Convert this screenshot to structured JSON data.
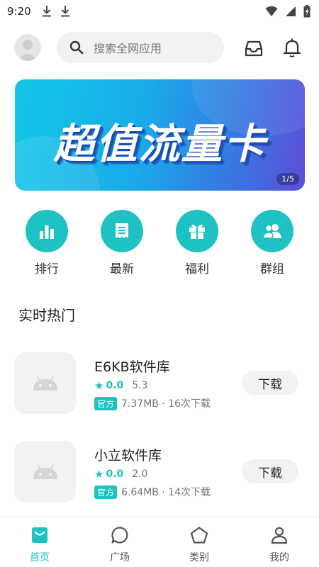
{
  "status_bar": {
    "time": "9:20"
  },
  "header": {
    "search_placeholder": "搜索全网应用"
  },
  "banner": {
    "title": "超值流量卡",
    "pager": "1/5"
  },
  "quick_actions": [
    {
      "label": "排行",
      "icon": "bar-chart-icon"
    },
    {
      "label": "最新",
      "icon": "receipt-icon"
    },
    {
      "label": "福利",
      "icon": "gift-icon"
    },
    {
      "label": "群组",
      "icon": "group-icon"
    }
  ],
  "section": {
    "title": "实时热门"
  },
  "apps": [
    {
      "name": "E6KB软件库",
      "rating": "0.0",
      "version": "5.3",
      "tag": "官方",
      "info": "7.37MB · 16次下载",
      "button": "下载"
    },
    {
      "name": "小立软件库",
      "rating": "0.0",
      "version": "2.0",
      "tag": "官方",
      "info": "6.64MB · 14次下载",
      "button": "下载"
    }
  ],
  "tabs": [
    {
      "label": "首页",
      "icon": "home-bag-icon",
      "active": true
    },
    {
      "label": "广场",
      "icon": "chat-bubble-icon",
      "active": false
    },
    {
      "label": "类别",
      "icon": "pentagon-icon",
      "active": false
    },
    {
      "label": "我的",
      "icon": "person-icon",
      "active": false
    }
  ],
  "colors": {
    "accent": "#1ec2c2",
    "banner_start": "#12c8e6",
    "banner_end": "#5d4ed8"
  }
}
